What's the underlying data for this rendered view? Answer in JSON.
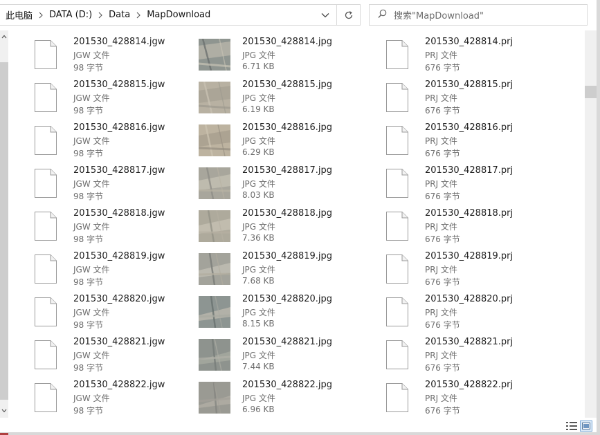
{
  "address": {
    "breadcrumbs": [
      "此电脑",
      "DATA (D:)",
      "Data",
      "MapDownload"
    ]
  },
  "search": {
    "placeholder": "搜索\"MapDownload\""
  },
  "icons": {
    "chevron_sep": "chevron-right-icon",
    "dropdown": "chevron-down-icon",
    "refresh": "refresh-icon",
    "search": "search-icon",
    "generic_file": "file-icon",
    "details_view": "details-view-icon",
    "tiles_view": "large-icons-view-icon"
  },
  "colors": {
    "border": "#d9d9d9",
    "secondary_text": "#6d6d6d",
    "scrollbar": "#cdcdcd"
  },
  "rows": [
    {
      "jgw": {
        "name": "201530_428814.jgw",
        "type": "JGW 文件",
        "size": "98 字节"
      },
      "jpg": {
        "name": "201530_428814.jpg",
        "type": "JPG 文件",
        "size": "6.71 KB"
      },
      "prj": {
        "name": "201530_428814.prj",
        "type": "PRJ 文件",
        "size": "676 字节"
      }
    },
    {
      "jgw": {
        "name": "201530_428815.jgw",
        "type": "JGW 文件",
        "size": "98 字节"
      },
      "jpg": {
        "name": "201530_428815.jpg",
        "type": "JPG 文件",
        "size": "6.19 KB"
      },
      "prj": {
        "name": "201530_428815.prj",
        "type": "PRJ 文件",
        "size": "676 字节"
      }
    },
    {
      "jgw": {
        "name": "201530_428816.jgw",
        "type": "JGW 文件",
        "size": "98 字节"
      },
      "jpg": {
        "name": "201530_428816.jpg",
        "type": "JPG 文件",
        "size": "6.29 KB"
      },
      "prj": {
        "name": "201530_428816.prj",
        "type": "PRJ 文件",
        "size": "676 字节"
      }
    },
    {
      "jgw": {
        "name": "201530_428817.jgw",
        "type": "JGW 文件",
        "size": "98 字节"
      },
      "jpg": {
        "name": "201530_428817.jpg",
        "type": "JPG 文件",
        "size": "8.03 KB"
      },
      "prj": {
        "name": "201530_428817.prj",
        "type": "PRJ 文件",
        "size": "676 字节"
      }
    },
    {
      "jgw": {
        "name": "201530_428818.jgw",
        "type": "JGW 文件",
        "size": "98 字节"
      },
      "jpg": {
        "name": "201530_428818.jpg",
        "type": "JPG 文件",
        "size": "7.36 KB"
      },
      "prj": {
        "name": "201530_428818.prj",
        "type": "PRJ 文件",
        "size": "676 字节"
      }
    },
    {
      "jgw": {
        "name": "201530_428819.jgw",
        "type": "JGW 文件",
        "size": "98 字节"
      },
      "jpg": {
        "name": "201530_428819.jpg",
        "type": "JPG 文件",
        "size": "7.68 KB"
      },
      "prj": {
        "name": "201530_428819.prj",
        "type": "PRJ 文件",
        "size": "676 字节"
      }
    },
    {
      "jgw": {
        "name": "201530_428820.jgw",
        "type": "JGW 文件",
        "size": "98 字节"
      },
      "jpg": {
        "name": "201530_428820.jpg",
        "type": "JPG 文件",
        "size": "8.15 KB"
      },
      "prj": {
        "name": "201530_428820.prj",
        "type": "PRJ 文件",
        "size": "676 字节"
      }
    },
    {
      "jgw": {
        "name": "201530_428821.jgw",
        "type": "JGW 文件",
        "size": "98 字节"
      },
      "jpg": {
        "name": "201530_428821.jpg",
        "type": "JPG 文件",
        "size": "7.44 KB"
      },
      "prj": {
        "name": "201530_428821.prj",
        "type": "PRJ 文件",
        "size": "676 字节"
      }
    },
    {
      "jgw": {
        "name": "201530_428822.jgw",
        "type": "JGW 文件",
        "size": "98 字节"
      },
      "jpg": {
        "name": "201530_428822.jpg",
        "type": "JPG 文件",
        "size": "6.96 KB"
      },
      "prj": {
        "name": "201530_428822.prj",
        "type": "PRJ 文件",
        "size": "676 字节"
      }
    }
  ]
}
